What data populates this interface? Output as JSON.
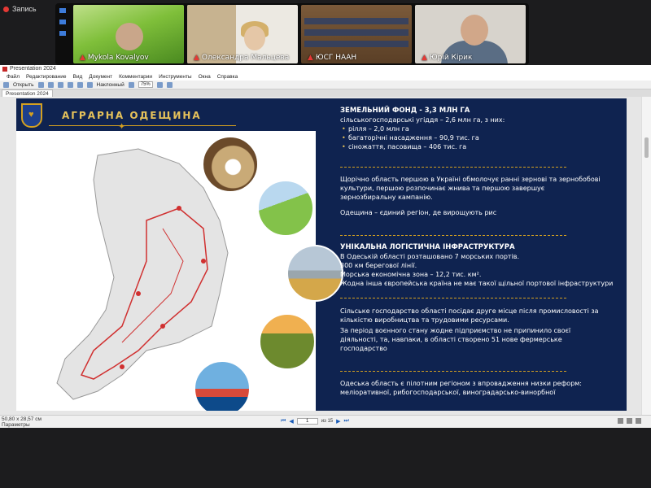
{
  "recording": {
    "label": "Запись"
  },
  "participants": [
    {
      "name": "Mykola Kovalyov"
    },
    {
      "name": "Олександра Мальцева"
    },
    {
      "name": "ЮСГ НААН"
    },
    {
      "name": "Юрій Кірик"
    }
  ],
  "window": {
    "title": "Presentation 2024"
  },
  "menu": [
    "Файл",
    "Редактирование",
    "Вид",
    "Документ",
    "Комментарии",
    "Инструменты",
    "Окна",
    "Справка"
  ],
  "toolbar": {
    "open_label": "Открыть",
    "view_label": "Наклонный",
    "zoom": "75%"
  },
  "tab": {
    "label": "Presentation 2024"
  },
  "slide": {
    "brand": "АГРАРНА ОДЕЩИНА",
    "land_title": "ЗЕМЕЛЬНИЙ ФОНД - 3,3 МЛН ГА",
    "land_sub": "сільськогосподарські угіддя – 2,6 млн га, з них:",
    "land_items": [
      "рілля – 2,0 млн га",
      "багаторічні насадження – 90,9 тис. га",
      "сіножаття, пасовища – 406 тис. га"
    ],
    "para1": "Щорічно область першою в Україні обмолочує ранні зернові та зернобобові культури, першою розпочинає жнива та першою завершує зернозбиральну кампанію.",
    "para2": "Одещина – єдиний регіон, де вирощують рис",
    "logistics_title": "УНІКАЛЬНА ЛОГІСТИЧНА ІНФРАСТРУКТУРА",
    "log_lines": [
      "В Одеській області розташовано 7 морських портів.",
      "300 км берегової лінії.",
      "Морська економічна зона – 12,2 тис. км².",
      "Жодна інша європейська країна не має такої щільної портової інфраструктури"
    ],
    "para3": "Сільське господарство області посідає друге місце після промисловості за кількістю виробництва та трудовими ресурсами.",
    "para4": "За період воєнного стану жодне підприємство не припинило своєї діяльності, та, навпаки, в області створено 51 нове фермерське господарство",
    "para5": "Одеська область є пілотним регіоном з впровадження низки реформ: меліоративної, рибогосподарської, виноградарсько-винорбної"
  },
  "status": {
    "dimensions": "50,80 x 28,57 см",
    "params": "Параметры",
    "page": "1",
    "of": "из 15"
  },
  "colors": {
    "slide_bg": "#0f2350",
    "gold": "#e6c25a",
    "route": "#d03030"
  }
}
